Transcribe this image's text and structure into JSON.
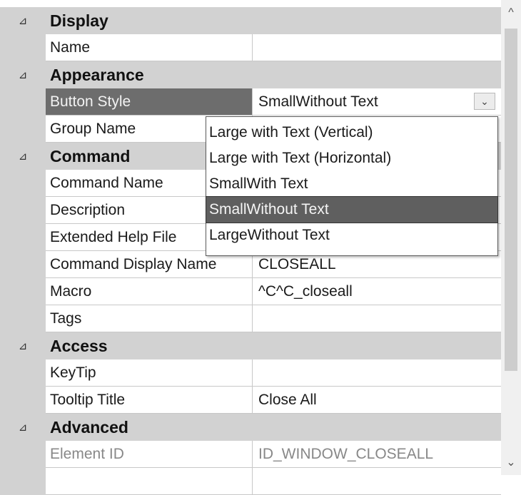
{
  "categories": {
    "display": "Display",
    "appearance": "Appearance",
    "command": "Command",
    "access": "Access",
    "advanced": "Advanced"
  },
  "properties": {
    "name": {
      "label": "Name",
      "value": ""
    },
    "button_style": {
      "label": "Button Style",
      "value": "SmallWithout Text"
    },
    "group_name": {
      "label": "Group Name",
      "value": ""
    },
    "command_name": {
      "label": "Command Name",
      "value": ""
    },
    "description": {
      "label": "Description",
      "value": ""
    },
    "extended_help_file": {
      "label": "Extended Help File",
      "value": ""
    },
    "command_display_name": {
      "label": "Command Display Name",
      "value": "CLOSEALL"
    },
    "macro": {
      "label": "Macro",
      "value": "^C^C_closeall"
    },
    "tags": {
      "label": "Tags",
      "value": ""
    },
    "keytip": {
      "label": "KeyTip",
      "value": ""
    },
    "tooltip_title": {
      "label": "Tooltip Title",
      "value": "Close All"
    },
    "element_id": {
      "label": "Element ID",
      "value": "ID_WINDOW_CLOSEALL"
    },
    "cut_off_row": {
      "label": "",
      "value": ""
    }
  },
  "dropdown": {
    "options": [
      "Large with Text (Vertical)",
      "Large with Text (Horizontal)",
      "SmallWith Text",
      "SmallWithout Text",
      "LargeWithout Text"
    ],
    "selected_index": 3
  },
  "icons": {
    "collapse": "⊿",
    "dropdown": "⌄",
    "scroll_up": "^",
    "scroll_down": "⌄"
  }
}
